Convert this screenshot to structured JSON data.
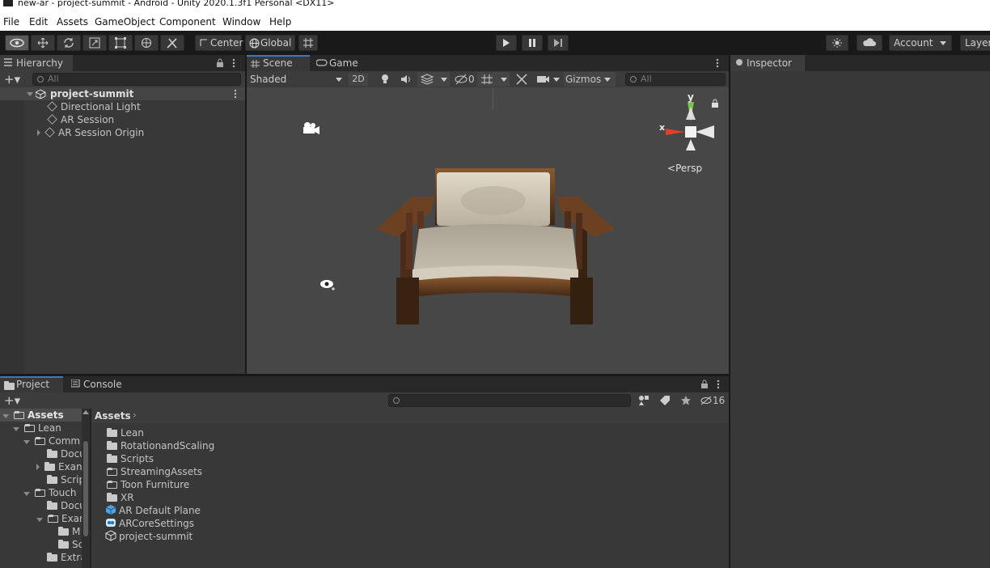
{
  "window": {
    "title": "new-ar - project-summit - Android - Unity 2020.1.3f1 Personal <DX11>"
  },
  "menu": [
    "File",
    "Edit",
    "Assets",
    "GameObject",
    "Component",
    "Window",
    "Help"
  ],
  "toolbar": {
    "pivot_label": "Center",
    "space_label": "Global",
    "account_label": "Account",
    "layers_label": "Layers"
  },
  "hierarchy": {
    "tab_label": "Hierarchy",
    "search_placeholder": "All",
    "scene_name": "project-summit",
    "items": [
      "Directional Light",
      "AR Session",
      "AR Session Origin"
    ]
  },
  "scene": {
    "tabs": [
      "Scene",
      "Game"
    ],
    "shading_mode": "Shaded",
    "mode_2d": "2D",
    "hidden_count": "0",
    "gizmos_label": "Gizmos",
    "search_placeholder": "All",
    "axis_y": "y",
    "axis_x": "x",
    "projection_label": "Persp"
  },
  "inspector": {
    "tab_label": "Inspector"
  },
  "project": {
    "tabs": [
      "Project",
      "Console"
    ],
    "hidden_count": "16",
    "breadcrumb": "Assets",
    "tree": [
      {
        "label": "Assets",
        "bold": true
      },
      {
        "label": "Lean"
      },
      {
        "label": "Comm"
      },
      {
        "label": "Docu"
      },
      {
        "label": "Exan"
      },
      {
        "label": "Scrip"
      },
      {
        "label": "Touch"
      },
      {
        "label": "Docu"
      },
      {
        "label": "Exan"
      },
      {
        "label": "M"
      },
      {
        "label": "Sc"
      },
      {
        "label": "Extra"
      }
    ],
    "assets": [
      "Lean",
      "RotationandScaling",
      "Scripts",
      "StreamingAssets",
      "Toon Furniture",
      "XR",
      "AR Default Plane",
      "ARCoreSettings",
      "project-summit"
    ]
  },
  "colors": {
    "accent": "#3a79bb",
    "panel": "#383838",
    "scene_bg": "#474747"
  }
}
